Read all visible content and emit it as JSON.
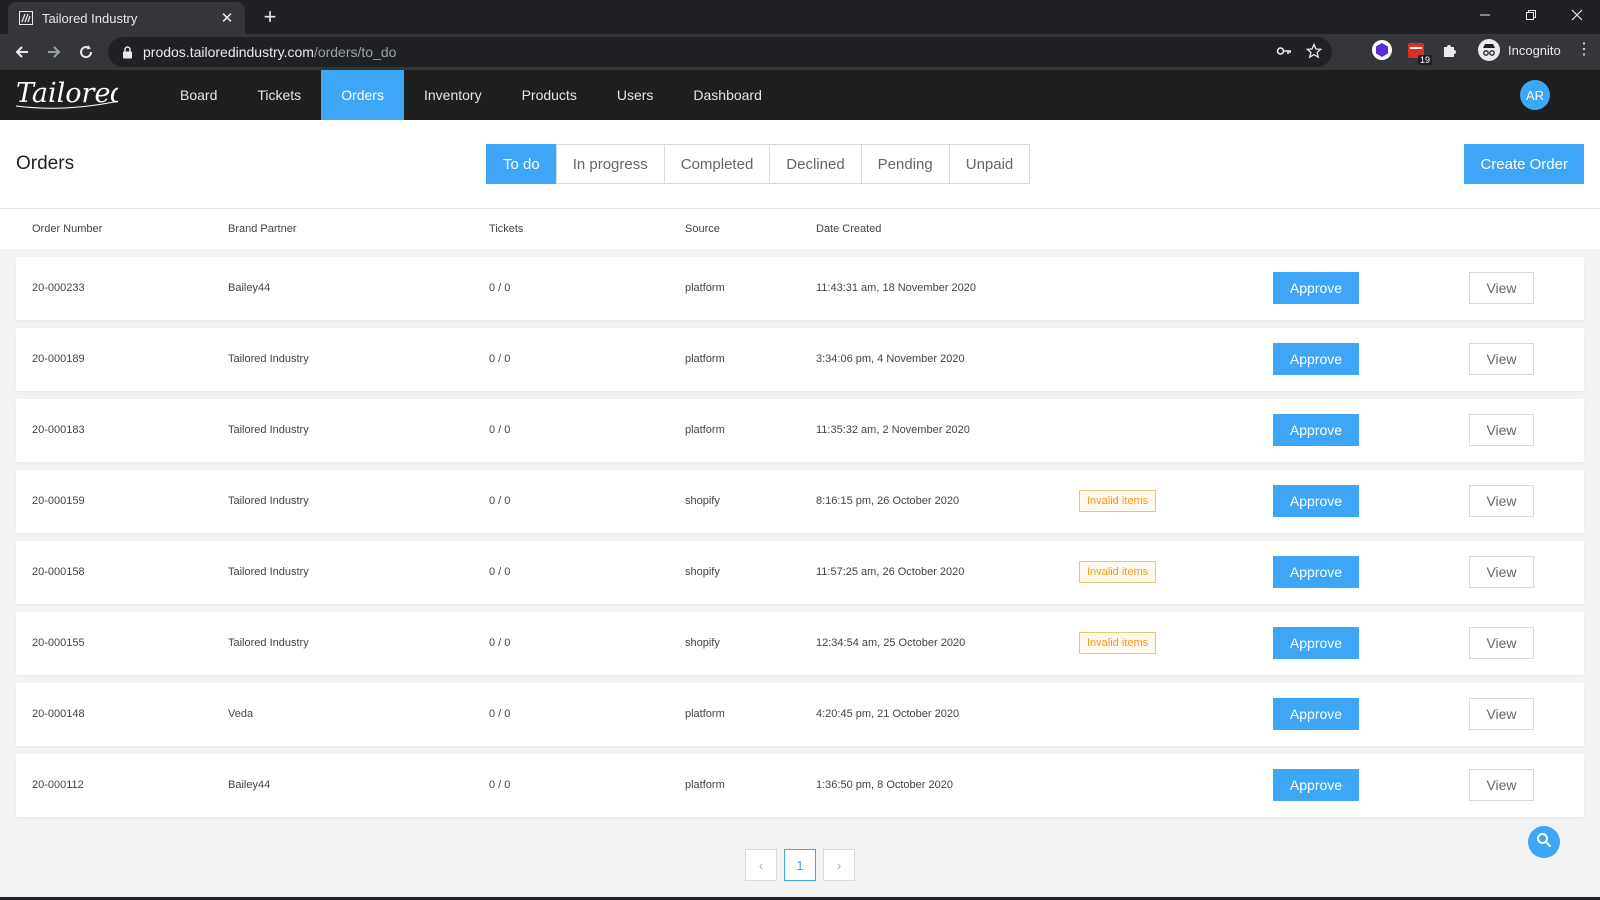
{
  "browser": {
    "tab_title": "Tailored Industry",
    "url_host": "prodos.tailoredindustry.com",
    "url_path": "/orders/to_do",
    "calendar_badge": "19",
    "incognito_label": "Incognito"
  },
  "nav": {
    "items": [
      "Board",
      "Tickets",
      "Orders",
      "Inventory",
      "Products",
      "Users",
      "Dashboard"
    ],
    "active_index": 2,
    "avatar_initials": "AR",
    "logo_text": "Tailored"
  },
  "header": {
    "title": "Orders",
    "filters": [
      "To do",
      "In progress",
      "Completed",
      "Declined",
      "Pending",
      "Unpaid"
    ],
    "active_filter": 0,
    "create_label": "Create Order"
  },
  "table": {
    "columns": [
      "Order Number",
      "Brand Partner",
      "Tickets",
      "Source",
      "Date Created"
    ],
    "approve_label": "Approve",
    "view_label": "View",
    "rows": [
      {
        "order": "20-000233",
        "brand": "Bailey44",
        "tickets": "0 / 0",
        "source": "platform",
        "date": "11:43:31 am, 18 November 2020",
        "badge": ""
      },
      {
        "order": "20-000189",
        "brand": "Tailored Industry",
        "tickets": "0 / 0",
        "source": "platform",
        "date": "3:34:06 pm, 4 November 2020",
        "badge": ""
      },
      {
        "order": "20-000183",
        "brand": "Tailored Industry",
        "tickets": "0 / 0",
        "source": "platform",
        "date": "11:35:32 am, 2 November 2020",
        "badge": ""
      },
      {
        "order": "20-000159",
        "brand": "Tailored Industry",
        "tickets": "0 / 0",
        "source": "shopify",
        "date": "8:16:15 pm, 26 October 2020",
        "badge": "Invalid items"
      },
      {
        "order": "20-000158",
        "brand": "Tailored Industry",
        "tickets": "0 / 0",
        "source": "shopify",
        "date": "11:57:25 am, 26 October 2020",
        "badge": "Invalid items"
      },
      {
        "order": "20-000155",
        "brand": "Tailored Industry",
        "tickets": "0 / 0",
        "source": "shopify",
        "date": "12:34:54 am, 25 October 2020",
        "badge": "Invalid items"
      },
      {
        "order": "20-000148",
        "brand": "Veda",
        "tickets": "0 / 0",
        "source": "platform",
        "date": "4:20:45 pm, 21 October 2020",
        "badge": ""
      },
      {
        "order": "20-000112",
        "brand": "Bailey44",
        "tickets": "0 / 0",
        "source": "platform",
        "date": "1:36:50 pm, 8 October 2020",
        "badge": ""
      }
    ]
  },
  "pagination": {
    "current_page": "1",
    "prev_glyph": "‹",
    "next_glyph": "›"
  },
  "colors": {
    "accent": "#3ea6f6",
    "nav_bg": "#1f1f1f",
    "badge_text": "#f39a1f"
  }
}
